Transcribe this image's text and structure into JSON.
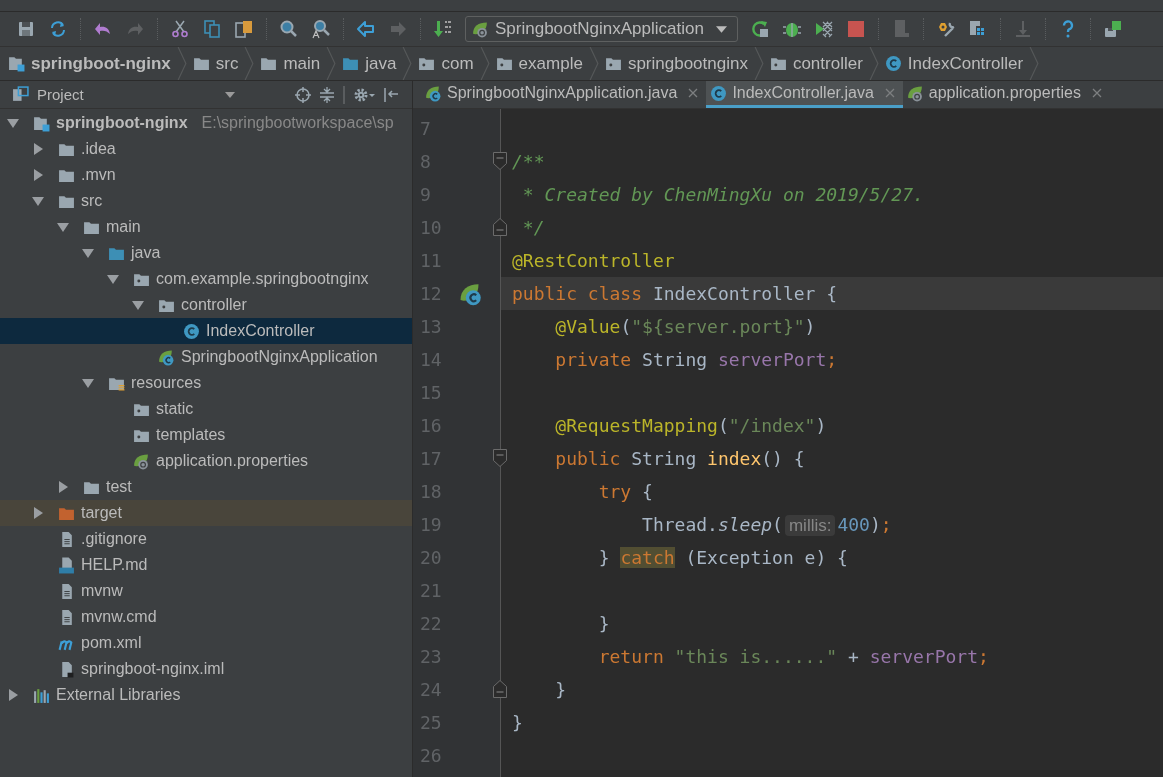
{
  "toolbar": {
    "run_config": "SpringbootNginxApplication"
  },
  "breadcrumbs": [
    {
      "label": "springboot-nginx",
      "kind": "module"
    },
    {
      "label": "src",
      "kind": "folder"
    },
    {
      "label": "main",
      "kind": "folder"
    },
    {
      "label": "java",
      "kind": "source"
    },
    {
      "label": "com",
      "kind": "package"
    },
    {
      "label": "example",
      "kind": "package"
    },
    {
      "label": "springbootnginx",
      "kind": "package"
    },
    {
      "label": "controller",
      "kind": "package"
    },
    {
      "label": "IndexController",
      "kind": "class"
    }
  ],
  "project_panel": {
    "title": "Project"
  },
  "tree": [
    {
      "label": "springboot-nginx",
      "path": "E:\\springbootworkspace\\sp",
      "kind": "module",
      "expanded": true,
      "selected": false,
      "children": [
        {
          "label": ".idea",
          "kind": "folder",
          "expanded": false,
          "selected": false
        },
        {
          "label": ".mvn",
          "kind": "folder",
          "expanded": false,
          "selected": false
        },
        {
          "label": "src",
          "kind": "folder",
          "expanded": true,
          "selected": false,
          "children": [
            {
              "label": "main",
              "kind": "folder",
              "expanded": true,
              "selected": false,
              "children": [
                {
                  "label": "java",
                  "kind": "source",
                  "expanded": true,
                  "selected": false,
                  "children": [
                    {
                      "label": "com.example.springbootnginx",
                      "kind": "package",
                      "expanded": true,
                      "selected": false,
                      "children": [
                        {
                          "label": "controller",
                          "kind": "package",
                          "expanded": true,
                          "selected": false,
                          "children": [
                            {
                              "label": "IndexController",
                              "kind": "class",
                              "selected": true
                            }
                          ]
                        },
                        {
                          "label": "SpringbootNginxApplication",
                          "kind": "spring-class",
                          "selected": false
                        }
                      ]
                    }
                  ]
                },
                {
                  "label": "resources",
                  "kind": "resources",
                  "expanded": true,
                  "selected": false,
                  "children": [
                    {
                      "label": "static",
                      "kind": "package",
                      "selected": false
                    },
                    {
                      "label": "templates",
                      "kind": "package",
                      "selected": false
                    },
                    {
                      "label": "application.properties",
                      "kind": "spring-file",
                      "selected": false
                    }
                  ]
                }
              ]
            },
            {
              "label": "test",
              "kind": "folder",
              "expanded": false,
              "selected": false
            }
          ]
        },
        {
          "label": "target",
          "kind": "excluded",
          "expanded": false,
          "selected": false
        },
        {
          "label": ".gitignore",
          "kind": "file",
          "selected": false
        },
        {
          "label": "HELP.md",
          "kind": "markdown",
          "selected": false
        },
        {
          "label": "mvnw",
          "kind": "file",
          "selected": false
        },
        {
          "label": "mvnw.cmd",
          "kind": "file",
          "selected": false
        },
        {
          "label": "pom.xml",
          "kind": "maven",
          "selected": false
        },
        {
          "label": "springboot-nginx.iml",
          "kind": "iml",
          "selected": false
        }
      ]
    },
    {
      "label": "External Libraries",
      "kind": "libraries",
      "expanded": false,
      "selected": false
    }
  ],
  "tabs": [
    {
      "label": "SpringbootNginxApplication.java",
      "kind": "spring-class",
      "selected": false
    },
    {
      "label": "IndexController.java",
      "kind": "class",
      "selected": true
    },
    {
      "label": "application.properties",
      "kind": "spring-file",
      "selected": false
    }
  ],
  "editor": {
    "lines": [
      {
        "number": "7",
        "current": false
      },
      {
        "number": "8",
        "current": false,
        "kind": "fold-start",
        "tokens": [
          {
            "kind": "comment",
            "text": "/**"
          }
        ]
      },
      {
        "number": "9",
        "current": false,
        "tokens": [
          {
            "kind": "comment",
            "text": " * Created by ChenMingXu on 2019/5/27."
          }
        ]
      },
      {
        "number": "10",
        "current": false,
        "kind": "fold-end",
        "tokens": [
          {
            "kind": "comment",
            "text": " */"
          }
        ]
      },
      {
        "number": "11",
        "current": false,
        "tokens": [
          {
            "kind": "annotation",
            "text": "@RestController"
          }
        ]
      },
      {
        "number": "12",
        "current": true,
        "kind": "bean",
        "tokens": [
          {
            "kind": "keyword",
            "text": "public class "
          },
          {
            "kind": "plain",
            "text": "IndexController {"
          }
        ]
      },
      {
        "number": "13",
        "current": false,
        "tokens": [
          {
            "kind": "annotation",
            "text": "    @Value"
          },
          {
            "kind": "plain",
            "text": "("
          },
          {
            "kind": "string",
            "text": "\"${server.port}\""
          },
          {
            "kind": "plain",
            "text": ")"
          }
        ]
      },
      {
        "number": "14",
        "current": false,
        "tokens": [
          {
            "kind": "keyword",
            "text": "    private "
          },
          {
            "kind": "plain",
            "text": "String "
          },
          {
            "kind": "field",
            "text": "serverPort"
          },
          {
            "kind": "keyword",
            "text": ";"
          }
        ]
      },
      {
        "number": "15",
        "current": false
      },
      {
        "number": "16",
        "current": false,
        "tokens": [
          {
            "kind": "annotation",
            "text": "    @RequestMapping"
          },
          {
            "kind": "plain",
            "text": "("
          },
          {
            "kind": "string",
            "text": "\"/index\""
          },
          {
            "kind": "plain",
            "text": ")"
          }
        ]
      },
      {
        "number": "17",
        "current": false,
        "kind": "fold-start",
        "tokens": [
          {
            "kind": "keyword",
            "text": "    public "
          },
          {
            "kind": "plain",
            "text": "String "
          },
          {
            "kind": "method",
            "text": "index"
          },
          {
            "kind": "plain",
            "text": "() {"
          }
        ]
      },
      {
        "number": "18",
        "current": false,
        "tokens": [
          {
            "kind": "keyword",
            "text": "        try "
          },
          {
            "kind": "plain",
            "text": "{"
          }
        ]
      },
      {
        "number": "19",
        "current": false,
        "tokens": [
          {
            "kind": "plain",
            "text": "            Thread."
          },
          {
            "kind": "static",
            "text": "sleep"
          },
          {
            "kind": "plain",
            "text": "("
          },
          {
            "kind": "hint",
            "text": "millis:"
          },
          {
            "kind": "number",
            "text": "400"
          },
          {
            "kind": "plain",
            "text": ")"
          },
          {
            "kind": "keyword",
            "text": ";"
          }
        ]
      },
      {
        "number": "20",
        "current": false,
        "tokens": [
          {
            "kind": "plain",
            "text": "        } "
          },
          {
            "kind": "match",
            "text": "catch"
          },
          {
            "kind": "plain",
            "text": " (Exception e) {"
          }
        ]
      },
      {
        "number": "21",
        "current": false
      },
      {
        "number": "22",
        "current": false,
        "tokens": [
          {
            "kind": "plain",
            "text": "        }"
          }
        ]
      },
      {
        "number": "23",
        "current": false,
        "tokens": [
          {
            "kind": "keyword",
            "text": "        return "
          },
          {
            "kind": "string",
            "text": "\"this is......\""
          },
          {
            "kind": "plain",
            "text": " + "
          },
          {
            "kind": "field",
            "text": "serverPort"
          },
          {
            "kind": "keyword",
            "text": ";"
          }
        ]
      },
      {
        "number": "24",
        "current": false,
        "kind": "fold-end",
        "tokens": [
          {
            "kind": "plain",
            "text": "    }"
          }
        ]
      },
      {
        "number": "25",
        "current": false,
        "tokens": [
          {
            "kind": "plain",
            "text": "}"
          }
        ]
      },
      {
        "number": "26",
        "current": false
      }
    ]
  }
}
